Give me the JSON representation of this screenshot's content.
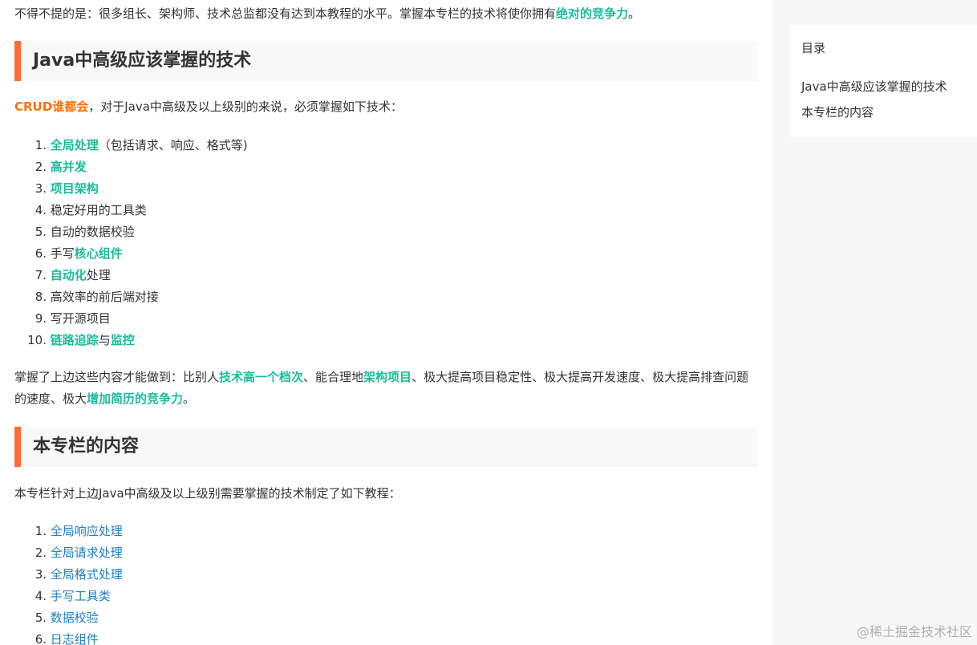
{
  "article": {
    "intro": {
      "text": "不得不提的是：很多组长、架构师、技术总监都没有达到本教程的水平。掌握本专栏的技术将使你拥有",
      "highlight": "绝对的竞争力",
      "end": "。"
    },
    "section1": {
      "heading": "Java中高级应该掌握的技术",
      "crud": "CRUD谁都会",
      "crud_rest": "，对于Java中高级及以上级别的来说，必须掌握如下技术：",
      "items": [
        {
          "num": "1.",
          "strong": "全局处理",
          "rest": "（包括请求、响应、格式等)"
        },
        {
          "num": "2.",
          "strong": "高并发",
          "rest": ""
        },
        {
          "num": "3.",
          "strong": "项目架构",
          "rest": ""
        },
        {
          "num": "4.",
          "text": "稳定好用的工具类"
        },
        {
          "num": "5.",
          "text": "自动的数据校验"
        },
        {
          "num": "6.",
          "pre": "手写",
          "strong": "核心组件"
        },
        {
          "num": "7.",
          "strong": "自动化",
          "rest": "处理"
        },
        {
          "num": "8.",
          "text": "高效率的前后端对接"
        },
        {
          "num": "9.",
          "text": "写开源项目"
        },
        {
          "num": "10.",
          "strong": "链路追踪",
          "mid": "与",
          "strong2": "监控"
        }
      ],
      "summary": {
        "t1": "掌握了上边这些内容才能做到：比别人",
        "h1": "技术高一个档次",
        "t2": "、能合理地",
        "h2": "架构项目",
        "t3": "、极大提高项目稳定性、极大提高开发速度、极大提高排查问题的速度、极大",
        "h3": "增加简历的竞争力",
        "t4": "。"
      }
    },
    "section2": {
      "heading": "本专栏的内容",
      "intro": "本专栏针对上边Java中高级及以上级别需要掌握的技术制定了如下教程：",
      "items": [
        {
          "num": "1.",
          "label": "全局响应处理"
        },
        {
          "num": "2.",
          "label": "全局请求处理"
        },
        {
          "num": "3.",
          "label": "全局格式处理"
        },
        {
          "num": "4.",
          "label": "手写工具类"
        },
        {
          "num": "5.",
          "label": "数据校验"
        },
        {
          "num": "6.",
          "label": "日志组件"
        }
      ]
    }
  },
  "toc": {
    "title": "目录",
    "items": [
      "Java中高级应该掌握的技术",
      "本专栏的内容"
    ]
  },
  "watermark": "@稀土掘金技术社区",
  "colors": {
    "accent_orange": "#ff6b35",
    "highlight_green": "#1bbc9b",
    "crud_orange": "#ff6f00",
    "link_blue": "#1e80c6"
  }
}
